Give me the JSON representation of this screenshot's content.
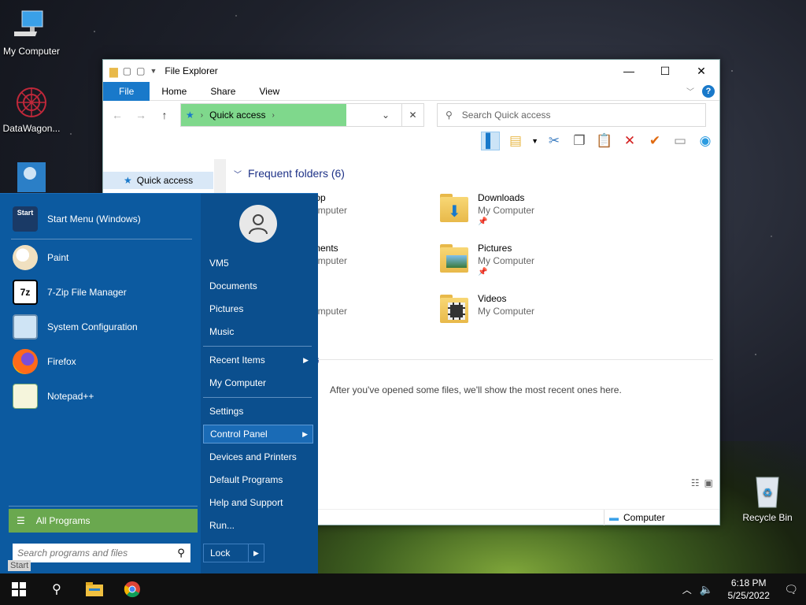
{
  "desktop": {
    "icons": [
      {
        "label": "My Computer"
      },
      {
        "label": "DataWagon..."
      },
      {
        "label": "Recycle Bin"
      }
    ]
  },
  "explorer": {
    "title": "File Explorer",
    "tabs": [
      "File",
      "Home",
      "Share",
      "View"
    ],
    "address": {
      "location": "Quick access"
    },
    "search": {
      "placeholder": "Search Quick access"
    },
    "nav": {
      "quick_access": "Quick access"
    },
    "group_heading": "Frequent folders (6)",
    "folders": [
      {
        "name": "top",
        "location": "omputer"
      },
      {
        "name": "Downloads",
        "location": "My Computer"
      },
      {
        "name": "ments",
        "location": "omputer"
      },
      {
        "name": "Pictures",
        "location": "My Computer"
      },
      {
        "name": "c",
        "location": "omputer"
      },
      {
        "name": "Videos",
        "location": "My Computer"
      }
    ],
    "recent_heading_fragment": ")",
    "recent_message": "After you've opened some files, we'll show the most recent ones here.",
    "status": {
      "computer": "Computer"
    }
  },
  "start_menu": {
    "programs": [
      {
        "label": "Start Menu (Windows)",
        "icon_text": "Start"
      },
      {
        "label": "Paint",
        "icon_text": ""
      },
      {
        "label": "7-Zip File Manager",
        "icon_text": "7z"
      },
      {
        "label": "System Configuration",
        "icon_text": ""
      },
      {
        "label": "Firefox",
        "icon_text": ""
      },
      {
        "label": "Notepad++",
        "icon_text": ""
      }
    ],
    "all_programs": "All Programs",
    "search_placeholder": "Search programs and files",
    "start_label": "Start",
    "right_items": [
      {
        "label": "VM5"
      },
      {
        "label": "Documents"
      },
      {
        "label": "Pictures"
      },
      {
        "label": "Music"
      },
      {
        "label": "Recent Items"
      },
      {
        "label": "My Computer"
      },
      {
        "label": "Settings"
      },
      {
        "label": "Control Panel"
      },
      {
        "label": "Devices and Printers"
      },
      {
        "label": "Default Programs"
      },
      {
        "label": "Help and Support"
      },
      {
        "label": "Run..."
      }
    ],
    "lock": "Lock"
  },
  "taskbar": {
    "time": "6:18 PM",
    "date": "5/25/2022"
  },
  "colors": {
    "start_menu_bg": "#0c5aa0",
    "all_programs_bg": "#6aa84f",
    "address_green": "#7fd88c",
    "file_tab": "#1979ca"
  }
}
